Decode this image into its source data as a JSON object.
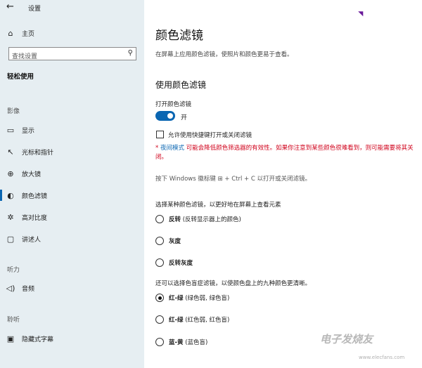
{
  "window": {
    "title": "设置",
    "back_icon": "back-arrow-icon"
  },
  "sidebar": {
    "home": {
      "label": "主页",
      "icon": "home-icon"
    },
    "search": {
      "placeholder": "查找设置",
      "icon": "search-icon"
    },
    "category": "轻松使用",
    "groups": [
      {
        "head": "影像",
        "items": [
          {
            "label": "显示",
            "icon": "display-icon"
          },
          {
            "label": "光标和指针",
            "icon": "cursor-icon"
          },
          {
            "label": "放大镜",
            "icon": "magnifier-icon"
          },
          {
            "label": "颜色滤镜",
            "icon": "color-filter-icon",
            "active": true
          },
          {
            "label": "高对比度",
            "icon": "contrast-icon"
          },
          {
            "label": "讲述人",
            "icon": "narrator-icon"
          }
        ]
      },
      {
        "head": "听力",
        "items": [
          {
            "label": "音频",
            "icon": "speaker-icon"
          }
        ]
      },
      {
        "head": "聆听",
        "items": [
          {
            "label": "隐藏式字幕",
            "icon": "captions-icon"
          }
        ]
      }
    ]
  },
  "main": {
    "title": "颜色滤镜",
    "description": "在屏幕上应用颜色滤镜，使照片和颜色更易于查看。",
    "section_title": "使用颜色滤镜",
    "toggle_label": "打开颜色滤镜",
    "toggle_state": "开",
    "toggle_on": true,
    "shortcut_checkbox_label": "允许使用快捷键打开或关闭滤镜",
    "shortcut_checked": false,
    "warning_prefix": "* ",
    "warning_link": "夜间模式",
    "warning_rest": " 可能会降低颜色筛选器的有效性。如果你注意到某些颜色很难看到，则可能需要将其关闭。",
    "shortcut_hint": "按下 Windows 徽标键 ⊞ + Ctrl + C 以打开或关闭滤镜。",
    "filter_section_label": "选择某种颜色滤镜，以更好地在屏幕上查看元素",
    "filters": [
      {
        "name": "反转",
        "desc": " (反转显示器上的颜色)",
        "checked": false
      },
      {
        "name": "灰度",
        "desc": "",
        "checked": false
      },
      {
        "name": "反转灰度",
        "desc": "",
        "checked": false
      }
    ],
    "colorblind_section_label": "还可以选择色盲症滤镜，以使颜色盘上的九种颜色更清晰。",
    "colorblind_filters": [
      {
        "name": "红-绿",
        "desc": " (绿色弱, 绿色盲)",
        "checked": true
      },
      {
        "name": "红-绿",
        "desc": " (红色弱, 红色盲)",
        "checked": false
      },
      {
        "name": "蓝-黄",
        "desc": " (蓝色盲)",
        "checked": false
      }
    ]
  },
  "watermark": {
    "text": "电子发烧友",
    "sub": "www.elecfans.com"
  },
  "colors": {
    "accent": "#0a66b2",
    "warning": "#d0021b",
    "sidebar_bg": "#e6eef2"
  }
}
